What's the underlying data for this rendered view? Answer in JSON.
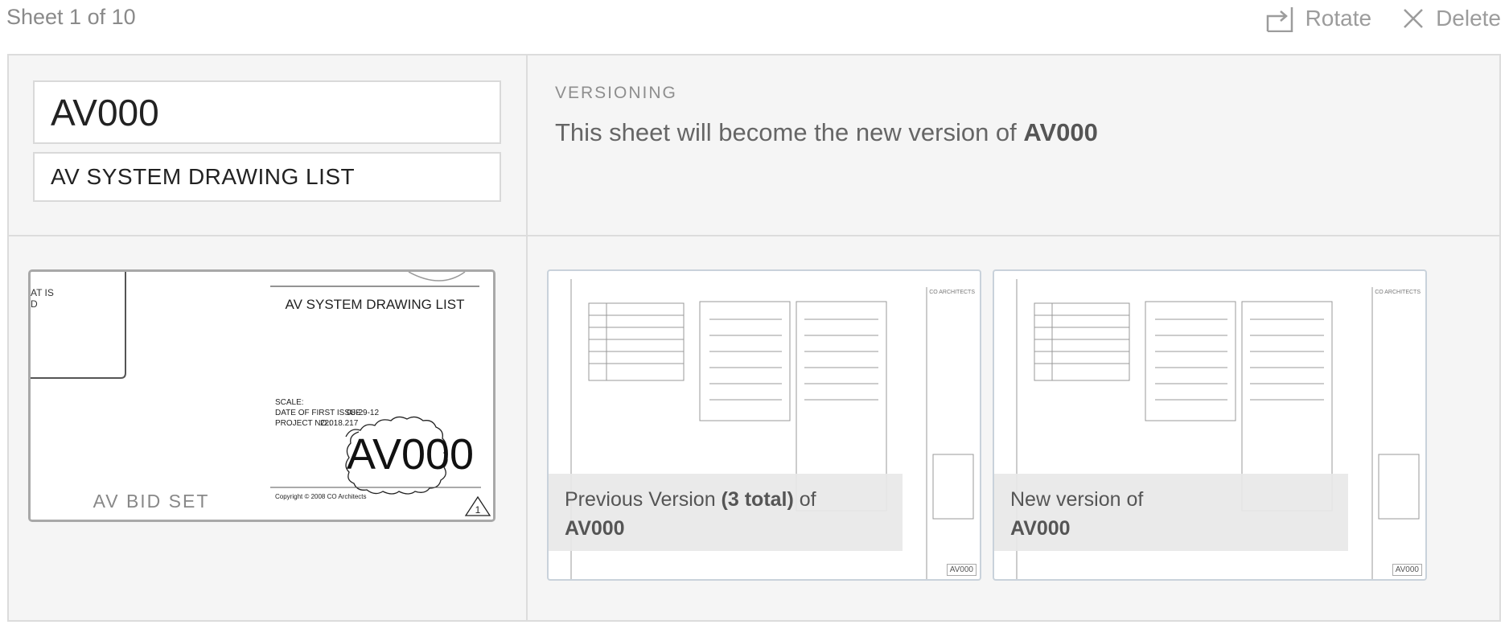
{
  "header": {
    "sheet_count": "Sheet 1 of 10",
    "rotate_label": "Rotate",
    "delete_label": "Delete",
    "rotate_icon": "rotate-icon",
    "delete_icon": "close-icon"
  },
  "sheet": {
    "number": "AV000",
    "title": "AV SYSTEM DRAWING LIST"
  },
  "versioning": {
    "label": "VERSIONING",
    "text_prefix": "This sheet will become the new version of ",
    "target": "AV000"
  },
  "preview": {
    "title": "AV SYSTEM DRAWING LIST",
    "scale_label": "SCALE:",
    "date_label": "DATE OF FIRST ISSUE:",
    "date_value": "08-29-12",
    "project_label": "PROJECT NO.:",
    "project_value": "22018.217",
    "sheet_number": "AV000",
    "bid_set": "AV  BID  SET",
    "copyright": "Copyright © 2008  CO Architects",
    "revision": "1",
    "corner_text_1": "AT  IS",
    "corner_text_2": "D"
  },
  "versions": {
    "previous": {
      "text_prefix": "Previous Version ",
      "count_text": "(3 total)",
      "text_suffix": " of",
      "sheet": "AV000",
      "tag": "AV000"
    },
    "new": {
      "text": "New version of",
      "sheet": "AV000",
      "tag": "AV000"
    }
  },
  "colors": {
    "panel_bg": "#f5f5f5",
    "border": "#dcdcdc",
    "muted_text": "#9c9c9c",
    "thumb_border": "#c9d2db"
  }
}
